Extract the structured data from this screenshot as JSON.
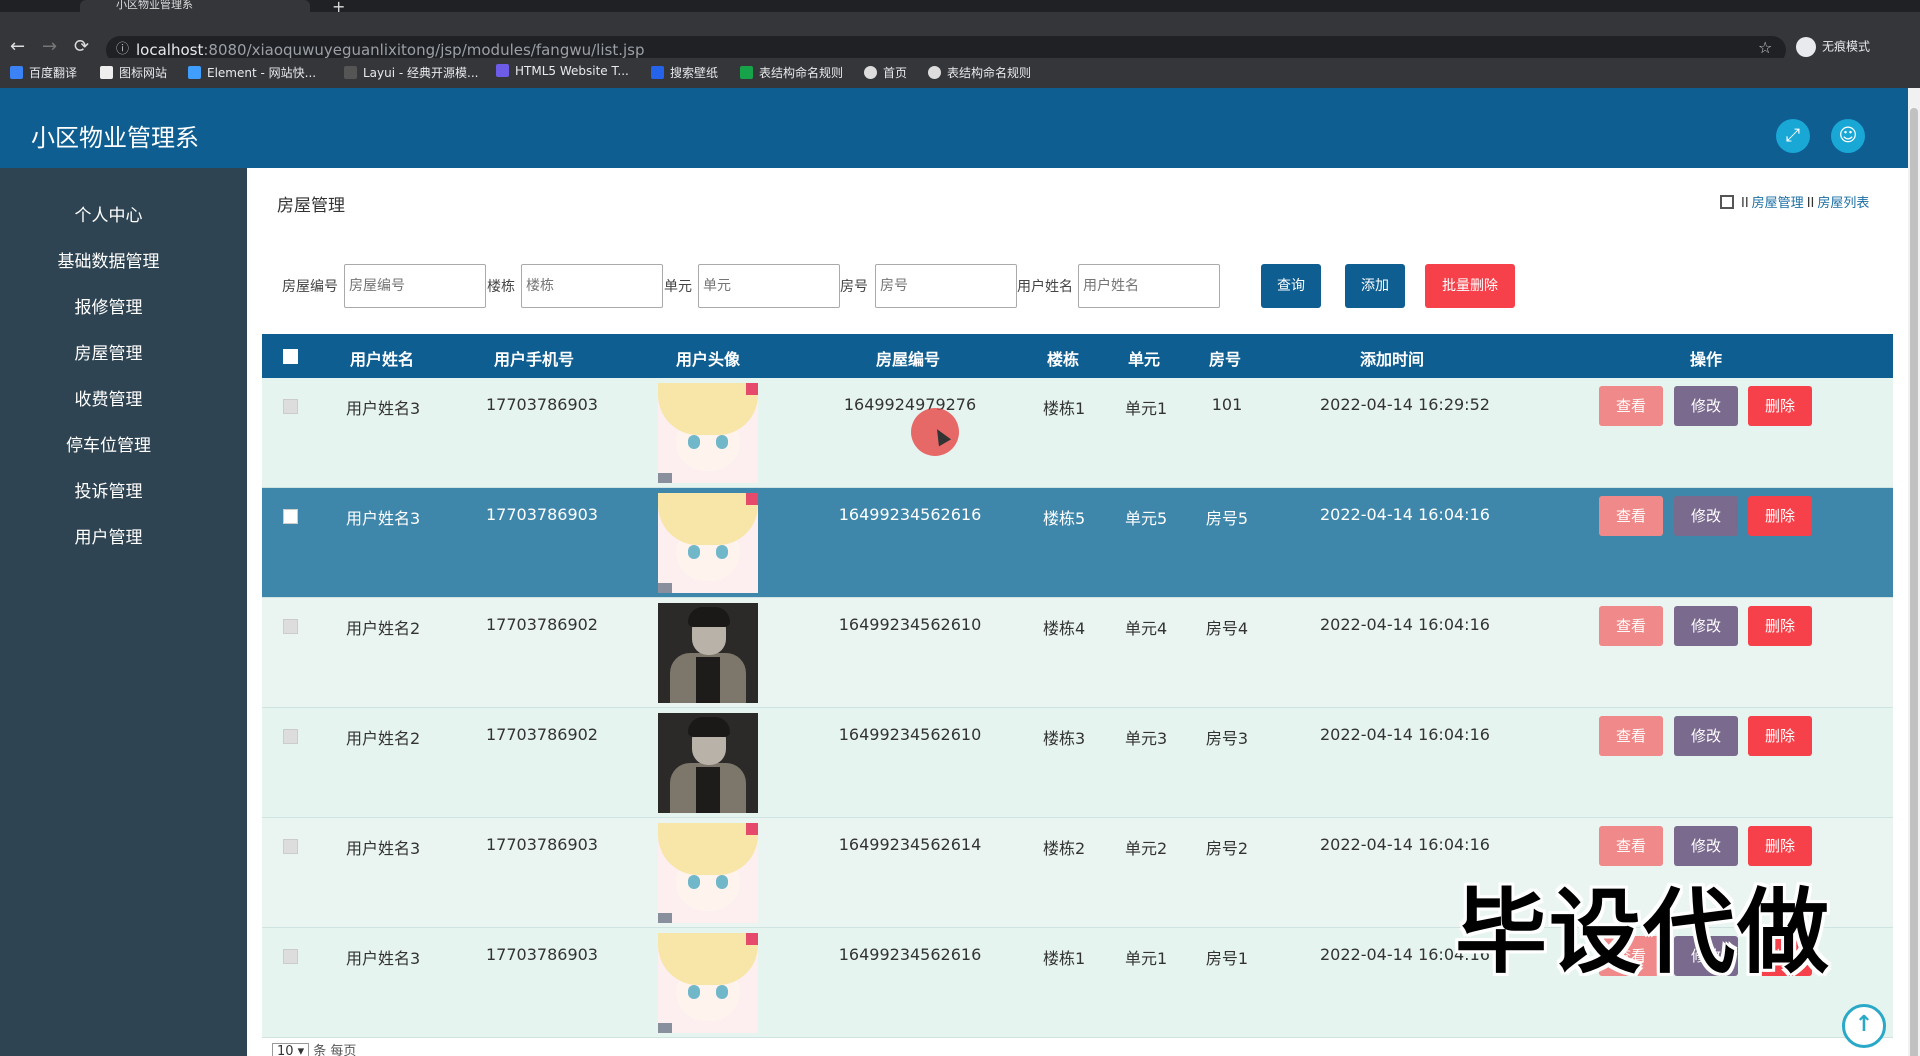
{
  "browser": {
    "tab_title": "小区物业管理系",
    "url_host": "localhost",
    "url_path": ":8080/xiaoquwuyeguanlixitong/jsp/modules/fangwu/list.jsp",
    "incognito_label": "无痕模式",
    "bookmarks": [
      "百度翻译",
      "图标网站",
      "Element - 网站快...",
      "Layui - 经典开源模...",
      "HTML5 Website T...",
      "搜索壁纸",
      "表结构命名规则",
      "首页",
      "表结构命名规则"
    ]
  },
  "app": {
    "title": "小区物业管理系",
    "colors": {
      "header": "#0e5e91",
      "sidebar": "#2f4452",
      "accent": "#19a7d6"
    }
  },
  "sidebar": {
    "items": [
      "个人中心",
      "基础数据管理",
      "报修管理",
      "房屋管理",
      "收费管理",
      "停车位管理",
      "投诉管理",
      "用户管理"
    ]
  },
  "page": {
    "title": "房屋管理",
    "breadcrumb": [
      "房屋管理",
      "房屋列表"
    ],
    "breadcrumb_sep": "II"
  },
  "search": {
    "fields": [
      {
        "label": "房屋编号",
        "placeholder": "房屋编号"
      },
      {
        "label": "楼栋",
        "placeholder": "楼栋"
      },
      {
        "label": "单元",
        "placeholder": "单元"
      },
      {
        "label": "房号",
        "placeholder": "房号"
      },
      {
        "label": "用户姓名",
        "placeholder": "用户姓名"
      }
    ],
    "query_label": "查询",
    "add_label": "添加",
    "batch_delete_label": "批量删除"
  },
  "table": {
    "columns": [
      "用户姓名",
      "用户手机号",
      "用户头像",
      "房屋编号",
      "楼栋",
      "单元",
      "房号",
      "添加时间",
      "操作"
    ],
    "actions": {
      "view": "查看",
      "edit": "修改",
      "delete": "删除"
    },
    "rows": [
      {
        "name": "用户姓名3",
        "phone": "17703786903",
        "avatar": "anime-girl",
        "house_no": "1649924979276",
        "building": "楼栋1",
        "unit": "单元1",
        "room": "101",
        "time": "2022-04-14 16:29:52"
      },
      {
        "name": "用户姓名3",
        "phone": "17703786903",
        "avatar": "anime-girl",
        "house_no": "16499234562616",
        "building": "楼栋5",
        "unit": "单元5",
        "room": "房号5",
        "time": "2022-04-14 16:04:16",
        "selected": true
      },
      {
        "name": "用户姓名2",
        "phone": "17703786902",
        "avatar": "man-photo",
        "house_no": "16499234562610",
        "building": "楼栋4",
        "unit": "单元4",
        "room": "房号4",
        "time": "2022-04-14 16:04:16"
      },
      {
        "name": "用户姓名2",
        "phone": "17703786902",
        "avatar": "man-photo",
        "house_no": "16499234562610",
        "building": "楼栋3",
        "unit": "单元3",
        "room": "房号3",
        "time": "2022-04-14 16:04:16"
      },
      {
        "name": "用户姓名3",
        "phone": "17703786903",
        "avatar": "anime-girl",
        "house_no": "16499234562614",
        "building": "楼栋2",
        "unit": "单元2",
        "room": "房号2",
        "time": "2022-04-14 16:04:16"
      },
      {
        "name": "用户姓名3",
        "phone": "17703786903",
        "avatar": "anime-girl",
        "house_no": "16499234562616",
        "building": "楼栋1",
        "unit": "单元1",
        "room": "房号1",
        "time": "2022-04-14 16:04:16"
      }
    ]
  },
  "pager": {
    "page_size": "10",
    "suffix": "条 每页"
  },
  "watermark": "毕设代做",
  "icons": {
    "fullscreen": "expand-icon",
    "user": "user-icon",
    "home": "home-icon",
    "back_to_top": "arrow-up-icon"
  }
}
